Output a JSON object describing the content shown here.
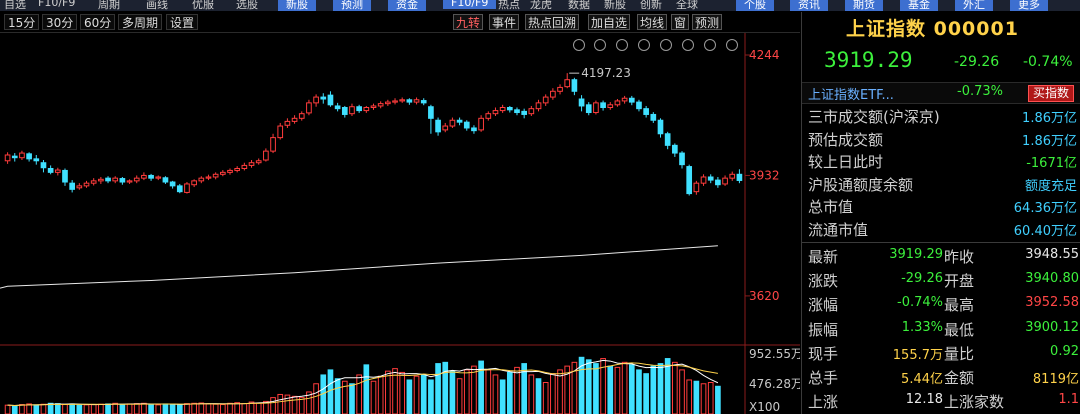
{
  "topbar": {
    "items": [
      "自选",
      "F10/F9",
      "周期",
      "画线",
      "优服",
      "选股"
    ],
    "tabs": [
      "新股",
      "预测",
      "资金",
      "F10/F9",
      "热点",
      "龙虎",
      "数据",
      "新股",
      "创新",
      "全球",
      "个股",
      "资讯",
      "期货",
      "基金",
      "外汇",
      "更多"
    ]
  },
  "periods": {
    "items": [
      "15分",
      "30分",
      "60分",
      "多周期",
      "设置"
    ],
    "functions": [
      "九转",
      "事件",
      "热点回溯",
      "加自选",
      "均线",
      "窗",
      "预测"
    ]
  },
  "chart_data": {
    "type": "candlestick",
    "yaxis_ticks": [
      "4244",
      "3932",
      "3620"
    ],
    "ylim": [
      3555,
      4244
    ],
    "annotation_high": "4197.23",
    "candles": [
      {
        "o": 3970,
        "c": 3985,
        "h": 3992,
        "l": 3962
      },
      {
        "o": 3982,
        "c": 3978,
        "h": 3990,
        "l": 3968
      },
      {
        "o": 3978,
        "c": 3990,
        "h": 3996,
        "l": 3972
      },
      {
        "o": 3988,
        "c": 3975,
        "h": 3992,
        "l": 3968
      },
      {
        "o": 3975,
        "c": 3970,
        "h": 3985,
        "l": 3960
      },
      {
        "o": 3965,
        "c": 3952,
        "h": 3972,
        "l": 3940
      },
      {
        "o": 3950,
        "c": 3940,
        "h": 3958,
        "l": 3935
      },
      {
        "o": 3940,
        "c": 3946,
        "h": 3952,
        "l": 3932
      },
      {
        "o": 3945,
        "c": 3915,
        "h": 3950,
        "l": 3905
      },
      {
        "o": 3912,
        "c": 3896,
        "h": 3920,
        "l": 3888
      },
      {
        "o": 3900,
        "c": 3905,
        "h": 3912,
        "l": 3895
      },
      {
        "o": 3905,
        "c": 3912,
        "h": 3918,
        "l": 3900
      },
      {
        "o": 3912,
        "c": 3918,
        "h": 3925,
        "l": 3906
      },
      {
        "o": 3918,
        "c": 3922,
        "h": 3928,
        "l": 3910
      },
      {
        "o": 3925,
        "c": 3918,
        "h": 3930,
        "l": 3912
      },
      {
        "o": 3918,
        "c": 3925,
        "h": 3930,
        "l": 3912
      },
      {
        "o": 3924,
        "c": 3915,
        "h": 3928,
        "l": 3908
      },
      {
        "o": 3915,
        "c": 3918,
        "h": 3922,
        "l": 3910
      },
      {
        "o": 3918,
        "c": 3925,
        "h": 3932,
        "l": 3912
      },
      {
        "o": 3925,
        "c": 3932,
        "h": 3940,
        "l": 3920
      },
      {
        "o": 3932,
        "c": 3925,
        "h": 3936,
        "l": 3918
      },
      {
        "o": 3925,
        "c": 3928,
        "h": 3932,
        "l": 3920
      },
      {
        "o": 3926,
        "c": 3915,
        "h": 3930,
        "l": 3910
      },
      {
        "o": 3915,
        "c": 3905,
        "h": 3918,
        "l": 3898
      },
      {
        "o": 3905,
        "c": 3890,
        "h": 3910,
        "l": 3886
      },
      {
        "o": 3888,
        "c": 3910,
        "h": 3915,
        "l": 3885
      },
      {
        "o": 3908,
        "c": 3918,
        "h": 3922,
        "l": 3902
      },
      {
        "o": 3918,
        "c": 3925,
        "h": 3930,
        "l": 3912
      },
      {
        "o": 3925,
        "c": 3928,
        "h": 3934,
        "l": 3920
      },
      {
        "o": 3928,
        "c": 3935,
        "h": 3940,
        "l": 3922
      },
      {
        "o": 3935,
        "c": 3940,
        "h": 3946,
        "l": 3930
      },
      {
        "o": 3940,
        "c": 3945,
        "h": 3950,
        "l": 3934
      },
      {
        "o": 3945,
        "c": 3950,
        "h": 3956,
        "l": 3940
      },
      {
        "o": 3950,
        "c": 3958,
        "h": 3965,
        "l": 3945
      },
      {
        "o": 3958,
        "c": 3965,
        "h": 3972,
        "l": 3952
      },
      {
        "o": 3965,
        "c": 3970,
        "h": 3976,
        "l": 3960
      },
      {
        "o": 3972,
        "c": 3995,
        "h": 4002,
        "l": 3968
      },
      {
        "o": 3995,
        "c": 4030,
        "h": 4040,
        "l": 3990
      },
      {
        "o": 4030,
        "c": 4060,
        "h": 4068,
        "l": 4025
      },
      {
        "o": 4062,
        "c": 4072,
        "h": 4080,
        "l": 4055
      },
      {
        "o": 4072,
        "c": 4080,
        "h": 4088,
        "l": 4066
      },
      {
        "o": 4080,
        "c": 4092,
        "h": 4098,
        "l": 4074
      },
      {
        "o": 4094,
        "c": 4120,
        "h": 4128,
        "l": 4088
      },
      {
        "o": 4120,
        "c": 4135,
        "h": 4142,
        "l": 4110
      },
      {
        "o": 4135,
        "c": 4130,
        "h": 4145,
        "l": 4118
      },
      {
        "o": 4140,
        "c": 4115,
        "h": 4150,
        "l": 4110
      },
      {
        "o": 4112,
        "c": 4105,
        "h": 4120,
        "l": 4098
      },
      {
        "o": 4108,
        "c": 4090,
        "h": 4112,
        "l": 4082
      },
      {
        "o": 4092,
        "c": 4110,
        "h": 4118,
        "l": 4086
      },
      {
        "o": 4110,
        "c": 4100,
        "h": 4115,
        "l": 4094
      },
      {
        "o": 4100,
        "c": 4108,
        "h": 4112,
        "l": 4094
      },
      {
        "o": 4108,
        "c": 4112,
        "h": 4118,
        "l": 4102
      },
      {
        "o": 4112,
        "c": 4118,
        "h": 4124,
        "l": 4106
      },
      {
        "o": 4118,
        "c": 4122,
        "h": 4128,
        "l": 4112
      },
      {
        "o": 4122,
        "c": 4125,
        "h": 4132,
        "l": 4116
      },
      {
        "o": 4125,
        "c": 4128,
        "h": 4134,
        "l": 4120
      },
      {
        "o": 4128,
        "c": 4122,
        "h": 4132,
        "l": 4115
      },
      {
        "o": 4122,
        "c": 4128,
        "h": 4134,
        "l": 4116
      },
      {
        "o": 4126,
        "c": 4120,
        "h": 4132,
        "l": 4114
      },
      {
        "o": 4110,
        "c": 4080,
        "h": 4115,
        "l": 4040
      },
      {
        "o": 4075,
        "c": 4045,
        "h": 4082,
        "l": 4035
      },
      {
        "o": 4050,
        "c": 4060,
        "h": 4068,
        "l": 4044
      },
      {
        "o": 4060,
        "c": 4075,
        "h": 4082,
        "l": 4055
      },
      {
        "o": 4075,
        "c": 4070,
        "h": 4082,
        "l": 4062
      },
      {
        "o": 4070,
        "c": 4055,
        "h": 4075,
        "l": 4048
      },
      {
        "o": 4055,
        "c": 4048,
        "h": 4062,
        "l": 4040
      },
      {
        "o": 4050,
        "c": 4080,
        "h": 4088,
        "l": 4045
      },
      {
        "o": 4080,
        "c": 4092,
        "h": 4098,
        "l": 4074
      },
      {
        "o": 4092,
        "c": 4100,
        "h": 4108,
        "l": 4086
      },
      {
        "o": 4100,
        "c": 4108,
        "h": 4115,
        "l": 4094
      },
      {
        "o": 4108,
        "c": 4102,
        "h": 4112,
        "l": 4095
      },
      {
        "o": 4102,
        "c": 4095,
        "h": 4108,
        "l": 4088
      },
      {
        "o": 4098,
        "c": 4090,
        "h": 4105,
        "l": 4080
      },
      {
        "o": 4092,
        "c": 4105,
        "h": 4112,
        "l": 4086
      },
      {
        "o": 4105,
        "c": 4120,
        "h": 4128,
        "l": 4098
      },
      {
        "o": 4120,
        "c": 4135,
        "h": 4142,
        "l": 4112
      },
      {
        "o": 4135,
        "c": 4150,
        "h": 4158,
        "l": 4128
      },
      {
        "o": 4150,
        "c": 4160,
        "h": 4168,
        "l": 4142
      },
      {
        "o": 4162,
        "c": 4180,
        "h": 4197,
        "l": 4158
      },
      {
        "o": 4180,
        "c": 4150,
        "h": 4185,
        "l": 4140
      },
      {
        "o": 4130,
        "c": 4112,
        "h": 4140,
        "l": 4098
      },
      {
        "o": 4115,
        "c": 4095,
        "h": 4122,
        "l": 4088
      },
      {
        "o": 4095,
        "c": 4120,
        "h": 4126,
        "l": 4090
      },
      {
        "o": 4120,
        "c": 4108,
        "h": 4126,
        "l": 4100
      },
      {
        "o": 4108,
        "c": 4115,
        "h": 4122,
        "l": 4102
      },
      {
        "o": 4115,
        "c": 4125,
        "h": 4130,
        "l": 4110
      },
      {
        "o": 4125,
        "c": 4132,
        "h": 4138,
        "l": 4118
      },
      {
        "o": 4132,
        "c": 4122,
        "h": 4138,
        "l": 4114
      },
      {
        "o": 4122,
        "c": 4105,
        "h": 4128,
        "l": 4098
      },
      {
        "o": 4105,
        "c": 4090,
        "h": 4112,
        "l": 4082
      },
      {
        "o": 4090,
        "c": 4075,
        "h": 4096,
        "l": 4068
      },
      {
        "o": 4075,
        "c": 4040,
        "h": 4080,
        "l": 4030
      },
      {
        "o": 4040,
        "c": 4010,
        "h": 4045,
        "l": 4000
      },
      {
        "o": 4010,
        "c": 3990,
        "h": 4015,
        "l": 3980
      },
      {
        "o": 3990,
        "c": 3960,
        "h": 3995,
        "l": 3950
      },
      {
        "o": 3955,
        "c": 3885,
        "h": 3960,
        "l": 3880
      },
      {
        "o": 3890,
        "c": 3912,
        "h": 3918,
        "l": 3882
      },
      {
        "o": 3912,
        "c": 3928,
        "h": 3935,
        "l": 3905
      },
      {
        "o": 3928,
        "c": 3920,
        "h": 3935,
        "l": 3912
      },
      {
        "o": 3920,
        "c": 3908,
        "h": 3928,
        "l": 3900
      },
      {
        "o": 3910,
        "c": 3925,
        "h": 3932,
        "l": 3905
      },
      {
        "o": 3925,
        "c": 3935,
        "h": 3942,
        "l": 3918
      },
      {
        "o": 3935,
        "c": 3919,
        "h": 3948,
        "l": 3912
      }
    ],
    "ma_line": [
      {
        "i": 0,
        "v": 3645
      },
      {
        "i": 20,
        "v": 3660
      },
      {
        "i": 40,
        "v": 3680
      },
      {
        "i": 60,
        "v": 3705
      },
      {
        "i": 80,
        "v": 3725
      },
      {
        "i": 99,
        "v": 3750
      }
    ],
    "volume": {
      "labels": [
        "952.55万",
        "476.28万",
        "X100"
      ],
      "ylim": [
        0,
        1000
      ],
      "bars": [
        140,
        130,
        150,
        160,
        145,
        155,
        170,
        165,
        150,
        160,
        140,
        145,
        150,
        155,
        160,
        170,
        150,
        160,
        165,
        170,
        150,
        145,
        160,
        155,
        150,
        165,
        170,
        175,
        160,
        155,
        150,
        170,
        180,
        165,
        190,
        175,
        200,
        260,
        310,
        300,
        280,
        260,
        350,
        480,
        620,
        700,
        560,
        520,
        480,
        620,
        780,
        520,
        600,
        680,
        720,
        660,
        540,
        600,
        620,
        540,
        800,
        820,
        680,
        560,
        700,
        760,
        840,
        700,
        620,
        540,
        660,
        740,
        800,
        620,
        560,
        500,
        640,
        700,
        760,
        820,
        900,
        860,
        800,
        880,
        760,
        740,
        820,
        780,
        700,
        640,
        760,
        800,
        880,
        820,
        700,
        540,
        520,
        480,
        500,
        440
      ],
      "colors": [
        "r",
        "g",
        "r",
        "r",
        "g",
        "r",
        "g",
        "g",
        "r",
        "g",
        "g",
        "r",
        "r",
        "r",
        "g",
        "r",
        "g",
        "r",
        "r",
        "r",
        "g",
        "r",
        "g",
        "g",
        "g",
        "r",
        "r",
        "r",
        "r",
        "r",
        "r",
        "r",
        "r",
        "r",
        "r",
        "r",
        "r",
        "r",
        "r",
        "r",
        "r",
        "r",
        "r",
        "r",
        "g",
        "g",
        "g",
        "r",
        "g",
        "r",
        "g",
        "r",
        "r",
        "r",
        "r",
        "r",
        "g",
        "r",
        "g",
        "g",
        "g",
        "g",
        "g",
        "r",
        "r",
        "r",
        "g",
        "r",
        "r",
        "g",
        "g",
        "r",
        "g",
        "r",
        "g",
        "r",
        "r",
        "r",
        "r",
        "r",
        "g",
        "g",
        "g",
        "r",
        "g",
        "r",
        "r",
        "g",
        "g",
        "g",
        "g",
        "g",
        "g",
        "r",
        "r",
        "r",
        "g",
        "r",
        "r",
        "g"
      ]
    }
  },
  "panel": {
    "title": "上证指数 000001",
    "price": "3919.29",
    "change": "-29.26",
    "change_pct": "-0.74%",
    "etf": {
      "name": "上证指数ETF...",
      "pct": "-0.73%",
      "buy_label": "买指数"
    },
    "info": [
      {
        "label": "三市成交额(沪深京)",
        "value": "1.86万亿",
        "color": "c"
      },
      {
        "label": "预估成交额",
        "value": "1.86万亿",
        "color": "c"
      },
      {
        "label": "较上日此时",
        "value": "-1671亿",
        "color": "g"
      },
      {
        "label": "沪股通额度余额",
        "value": "额度充足",
        "color": "c"
      },
      {
        "label": "总市值",
        "value": "64.36万亿",
        "color": "c"
      },
      {
        "label": "流通市值",
        "value": "60.40万亿",
        "color": "c"
      }
    ],
    "quotes": [
      {
        "l1": "最新",
        "v1": "3919.29",
        "c1": "g",
        "l2": "昨收",
        "v2": "3948.55",
        "c2": "w"
      },
      {
        "l1": "涨跌",
        "v1": "-29.26",
        "c1": "g",
        "l2": "开盘",
        "v2": "3940.80",
        "c2": "g"
      },
      {
        "l1": "涨幅",
        "v1": "-0.74%",
        "c1": "g",
        "l2": "最高",
        "v2": "3952.58",
        "c2": "r"
      },
      {
        "l1": "振幅",
        "v1": "1.33%",
        "c1": "g",
        "l2": "最低",
        "v2": "3900.12",
        "c2": "g"
      },
      {
        "l1": "现手",
        "v1": "155.7万",
        "c1": "y",
        "l2": "量比",
        "v2": "0.92",
        "c2": "g"
      },
      {
        "l1": "总手",
        "v1": "5.44亿",
        "c1": "y",
        "l2": "金额",
        "v2": "8119亿",
        "c2": "y"
      }
    ],
    "footer": {
      "l1": "上涨",
      "v1": "12.18",
      "l2": "上涨家数",
      "v2": "1.1"
    }
  }
}
